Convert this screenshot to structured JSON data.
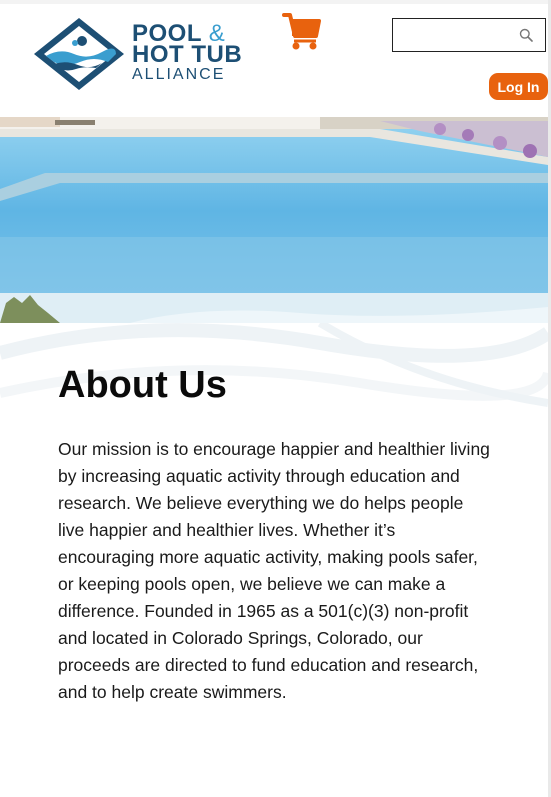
{
  "header": {
    "logo": {
      "line1": "POOL",
      "amp": "&",
      "line2": "HOT TUB",
      "line3": "ALLIANCE"
    },
    "cart_icon": "shopping-cart-icon",
    "search": {
      "placeholder": "",
      "value": "",
      "icon": "search-icon"
    },
    "login_label": "Log In"
  },
  "hero": {
    "image": "swimming-pool-photo"
  },
  "main": {
    "title": "About Us",
    "body": "Our mission is to encourage happier and healthier living by increasing aquatic activity through education and research. We believe everything we do helps people live happier and healthier lives. Whether it’s encouraging more aquatic activity, making pools safer, or keeping pools open, we believe we can make a difference. Founded in 1965 as a 501(c)(3) non-profit and located in Colorado Springs, Colorado, our proceeds are directed to fund education and research, and to help create swimmers."
  },
  "colors": {
    "brand_navy": "#1d4f74",
    "brand_blue": "#3a9ecf",
    "accent_orange": "#e8620e"
  }
}
